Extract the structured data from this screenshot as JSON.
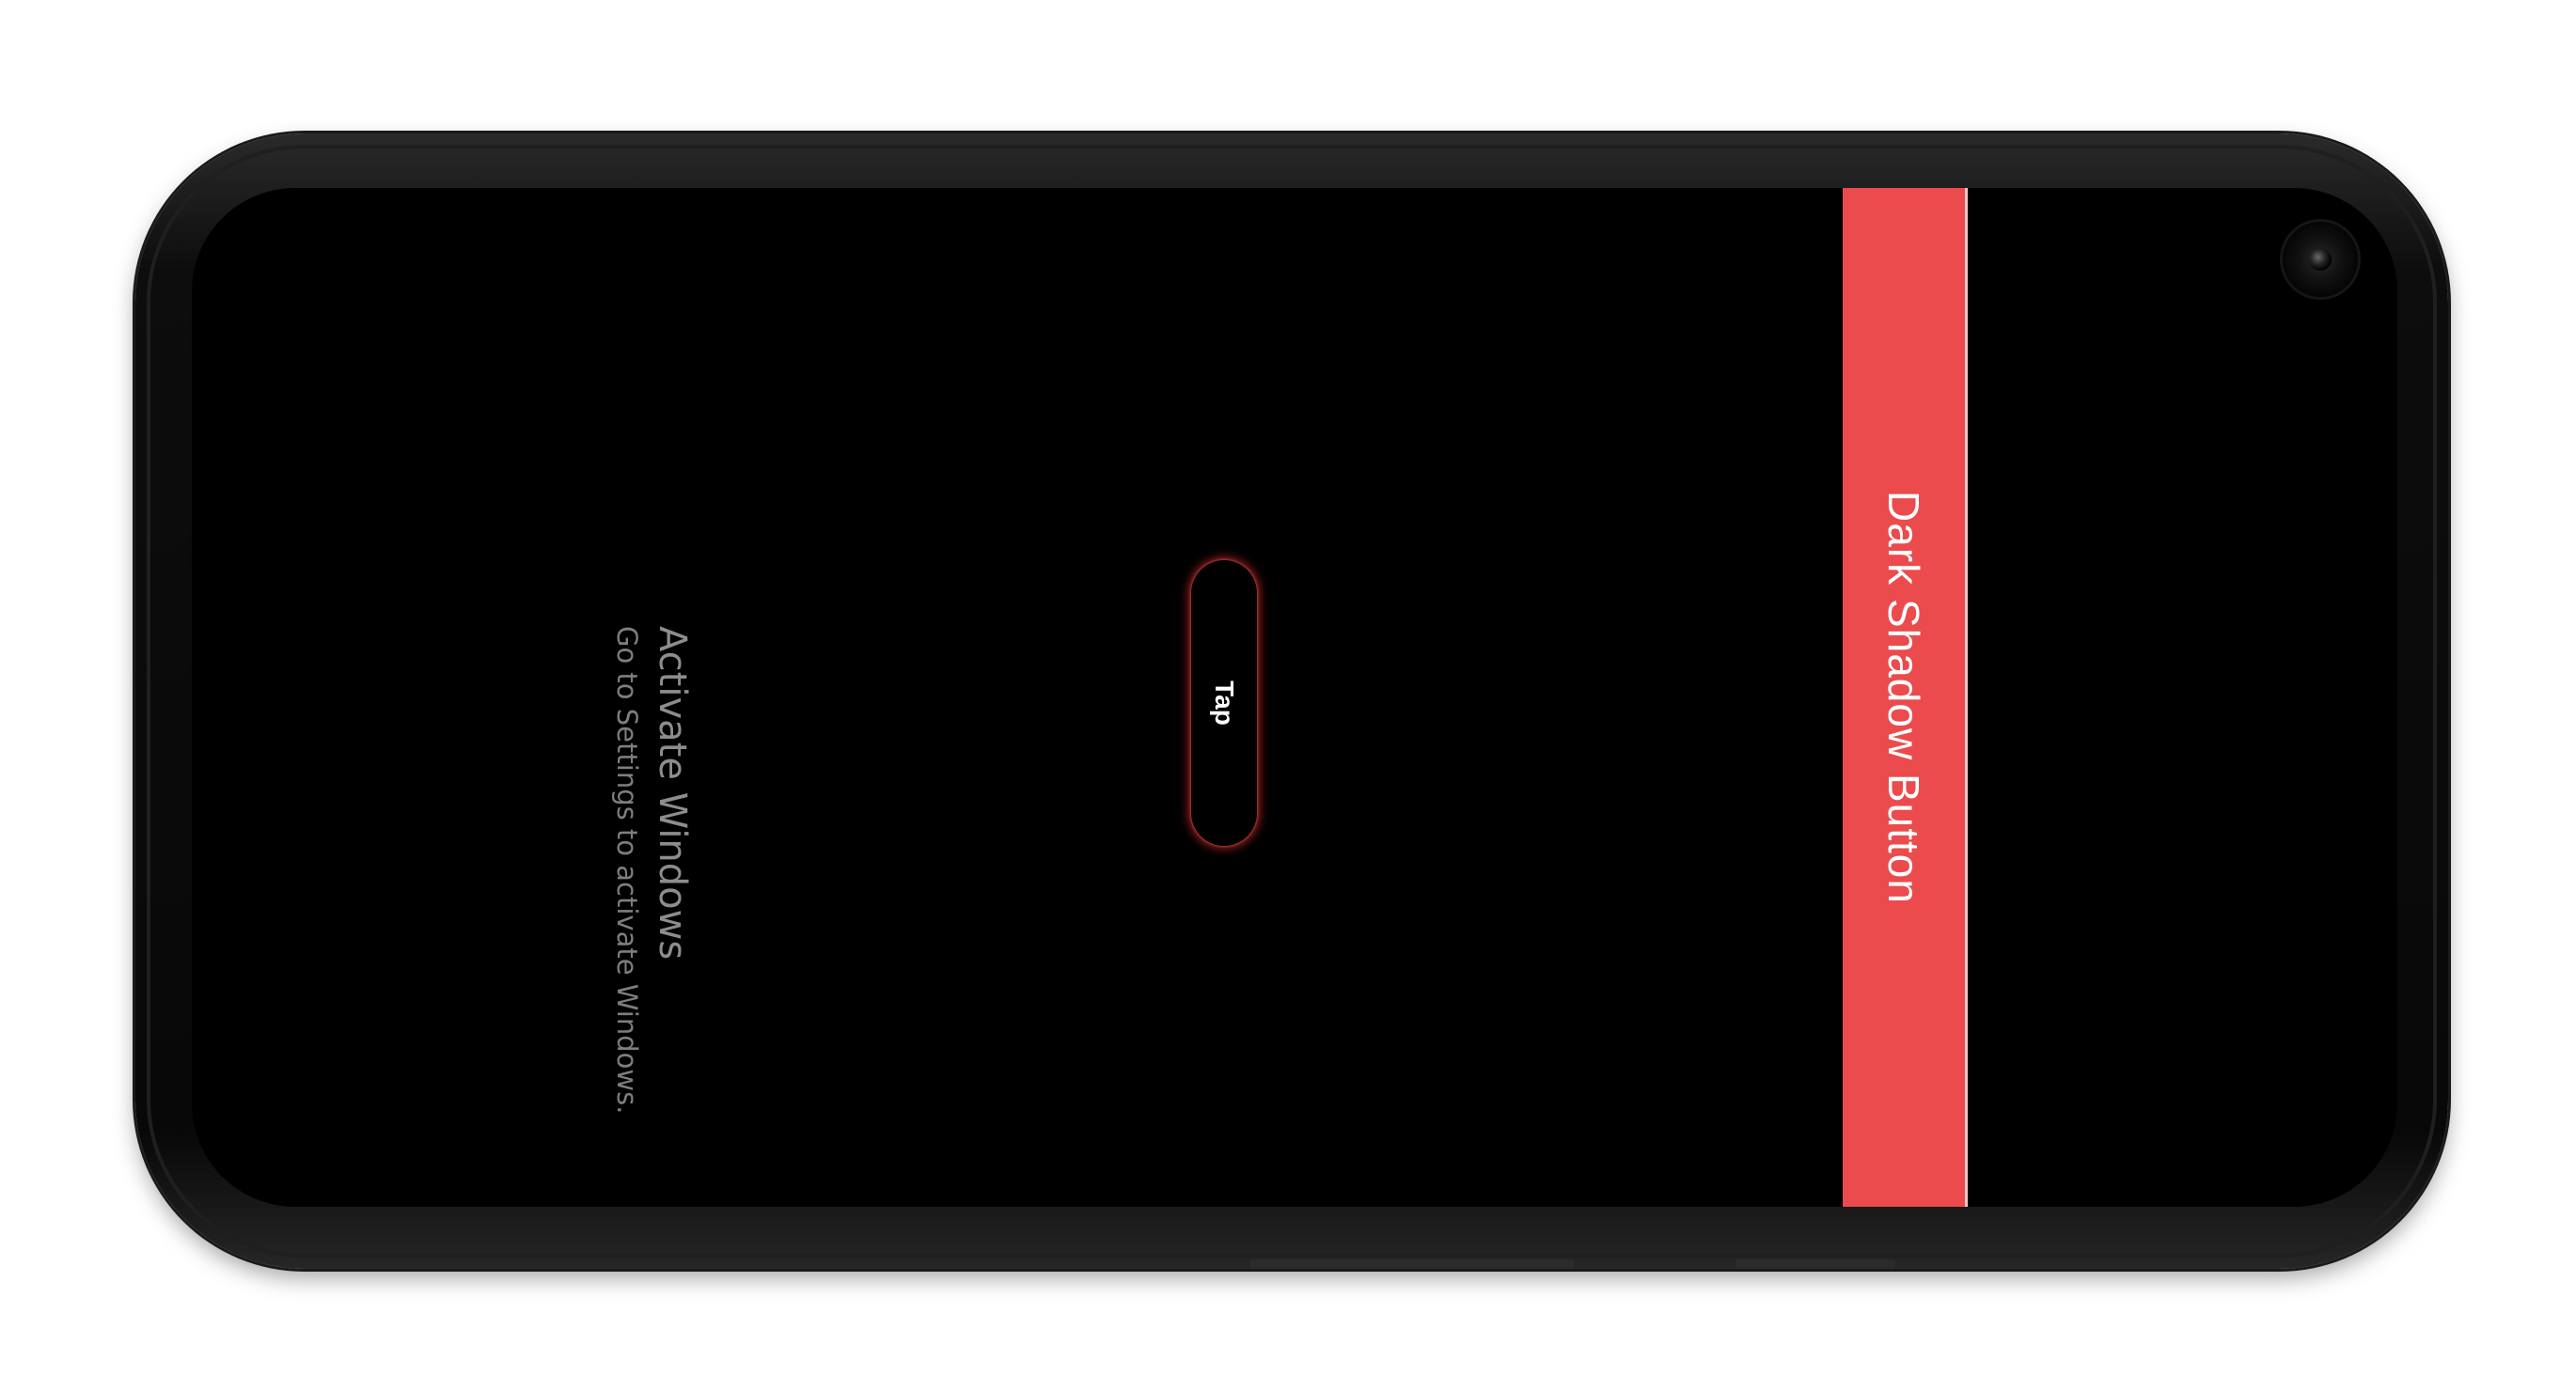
{
  "app": {
    "panel_button_label": "Dark Shadow Button",
    "tap_button_label": "Tap"
  },
  "watermark": {
    "title": "Activate Windows",
    "subtitle": "Go to Settings to activate Windows."
  },
  "colors": {
    "panel_red": "#eb4b4d",
    "screen_background": "#000000",
    "tap_glow": "#c82828"
  }
}
